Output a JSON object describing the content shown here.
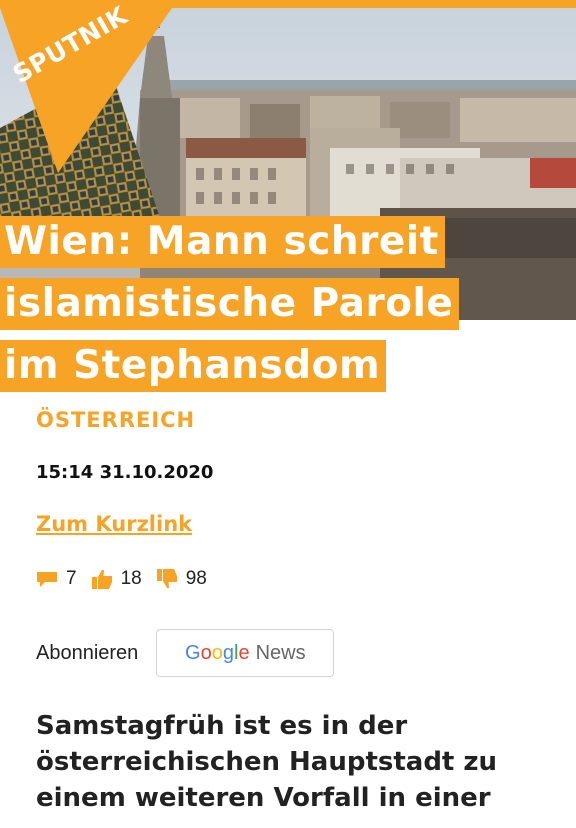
{
  "colors": {
    "accent": "#f7a325",
    "text": "#222222"
  },
  "logo": {
    "text": "SPUTNIK"
  },
  "hero_image": {
    "icon": "city-panorama-image"
  },
  "headline": {
    "line1": "Wien: Mann schreit",
    "line2": "islamistische Parole",
    "line3": "im Stephansdom"
  },
  "article": {
    "category": "ÖSTERREICH",
    "timestamp": "15:14 31.10.2020",
    "shortlink_label": "Zum Kurzlink"
  },
  "stats": {
    "comments": "7",
    "likes": "18",
    "dislikes": "98",
    "icons": [
      "comment-icon",
      "thumbs-up-icon",
      "thumbs-down-icon"
    ]
  },
  "subscribe": {
    "label": "Abonnieren",
    "google_letters": [
      "G",
      "o",
      "o",
      "g",
      "l",
      "e"
    ],
    "news_word": "News"
  },
  "lead": {
    "line1": "Samstagfrüh ist es in der",
    "line2": "österreichischen Hauptstadt zu",
    "line3": "einem weiteren Vorfall in einer"
  }
}
